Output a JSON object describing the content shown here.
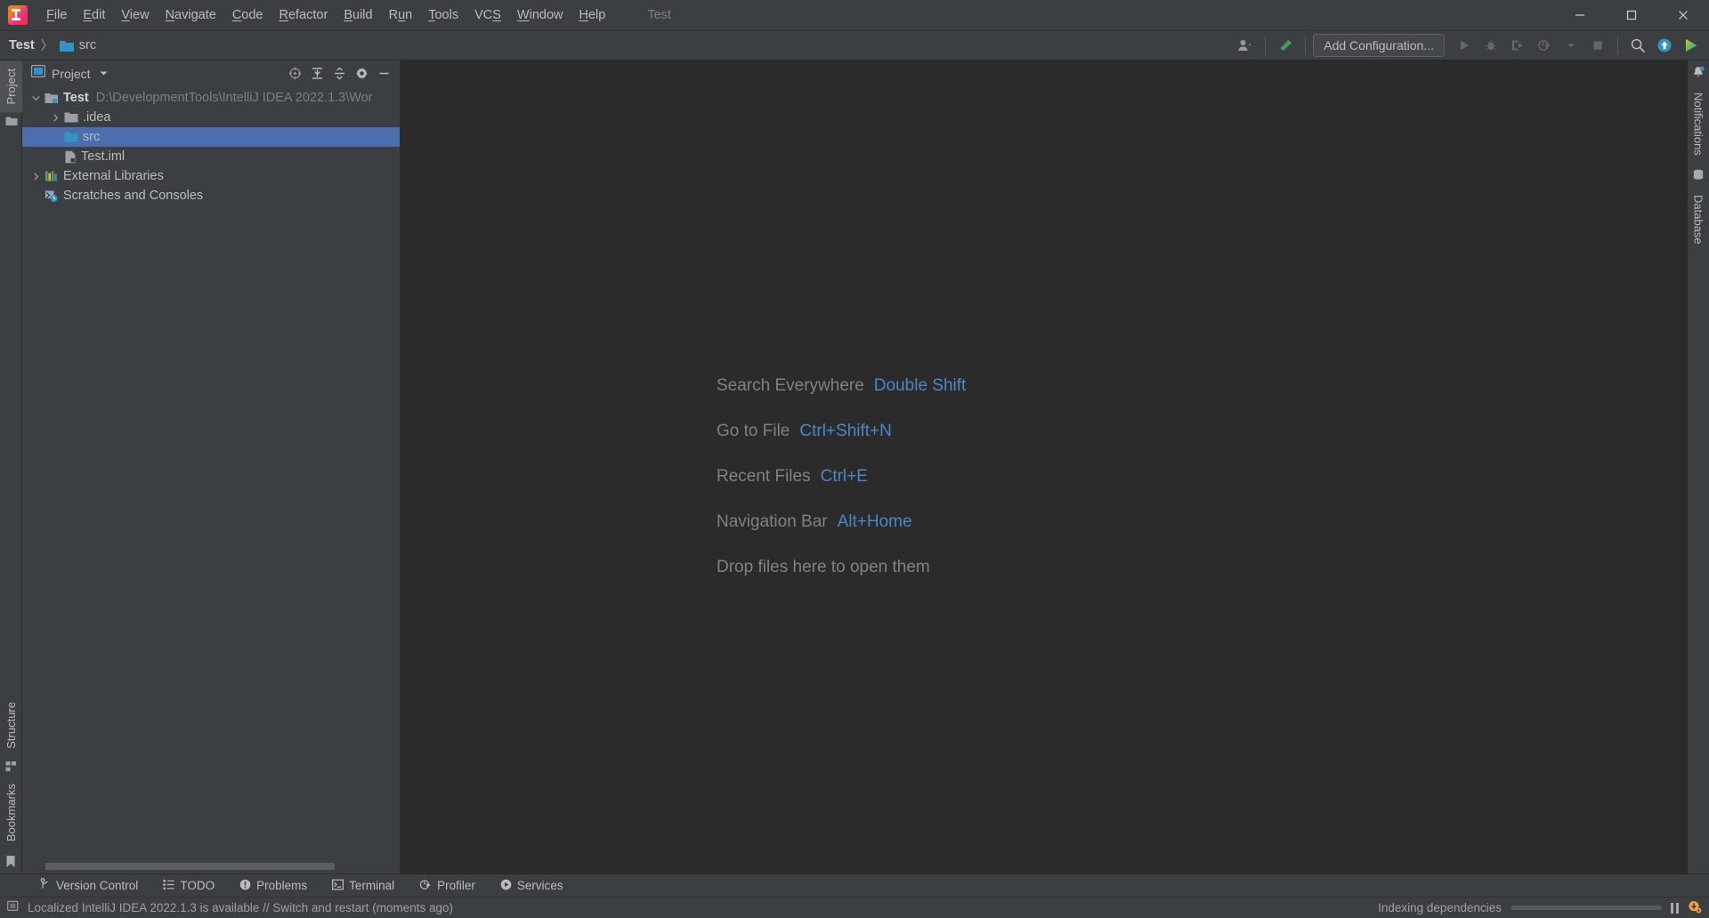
{
  "window": {
    "project_name": "Test",
    "minimize_label": "Minimize",
    "maximize_label": "Maximize",
    "close_label": "Close"
  },
  "menu": {
    "items": [
      {
        "label": "File",
        "mnemonic": "F"
      },
      {
        "label": "Edit",
        "mnemonic": "E"
      },
      {
        "label": "View",
        "mnemonic": "V"
      },
      {
        "label": "Navigate",
        "mnemonic": "N"
      },
      {
        "label": "Code",
        "mnemonic": "C"
      },
      {
        "label": "Refactor",
        "mnemonic": "R"
      },
      {
        "label": "Build",
        "mnemonic": "B"
      },
      {
        "label": "Run",
        "mnemonic": "u"
      },
      {
        "label": "Tools",
        "mnemonic": "T"
      },
      {
        "label": "VCS",
        "mnemonic": "S"
      },
      {
        "label": "Window",
        "mnemonic": "W"
      },
      {
        "label": "Help",
        "mnemonic": "H"
      }
    ]
  },
  "toolbar": {
    "breadcrumb": {
      "root": "Test",
      "separator": "〉",
      "leaf": "src"
    },
    "add_configuration_label": "Add Configuration...",
    "icons": {
      "user": "user-account-icon",
      "build": "build-hammer-icon",
      "run": "run-icon",
      "debug": "debug-icon",
      "run_coverage": "run-with-coverage-icon",
      "profile": "profile-icon",
      "stop": "stop-icon",
      "search": "search-icon",
      "update": "update-project-icon",
      "ide_services": "ide-services-icon"
    }
  },
  "left_strip": {
    "top": [
      {
        "label": "Project",
        "icon": "project-icon",
        "active": true
      },
      {
        "label": "",
        "icon": "folder-icon",
        "active": false
      }
    ],
    "bottom": [
      {
        "label": "Structure",
        "icon": "structure-icon"
      },
      {
        "label": "Bookmarks",
        "icon": "bookmarks-icon"
      }
    ]
  },
  "right_strip": {
    "top": [
      {
        "label": "Notifications",
        "icon": "notifications-bell-icon"
      },
      {
        "label": "Database",
        "icon": "database-icon"
      }
    ]
  },
  "project_panel": {
    "title": "Project",
    "tools": [
      {
        "name": "select-opened-file",
        "label": "Select Opened File"
      },
      {
        "name": "expand-all",
        "label": "Expand All"
      },
      {
        "name": "collapse-all",
        "label": "Collapse All"
      },
      {
        "name": "settings",
        "label": "Options"
      },
      {
        "name": "hide",
        "label": "Hide"
      }
    ],
    "tree": [
      {
        "label": "Test",
        "path": "D:\\DevelopmentTools\\IntelliJ IDEA 2022.1.3\\Wor",
        "icon": "module-icon",
        "indent": 0,
        "arrow": "expanded",
        "bold": true,
        "selected": false
      },
      {
        "label": ".idea",
        "path": "",
        "icon": "folder-grey-icon",
        "indent": 1,
        "arrow": "collapsed",
        "bold": false,
        "selected": false
      },
      {
        "label": "src",
        "path": "",
        "icon": "source-folder-icon",
        "indent": 1,
        "arrow": "none",
        "bold": false,
        "selected": true
      },
      {
        "label": "Test.iml",
        "path": "",
        "icon": "iml-file-icon",
        "indent": 1,
        "arrow": "none",
        "bold": false,
        "selected": false
      },
      {
        "label": "External Libraries",
        "path": "",
        "icon": "libraries-icon",
        "indent": 0,
        "arrow": "collapsed",
        "bold": false,
        "selected": false
      },
      {
        "label": "Scratches and Consoles",
        "path": "",
        "icon": "scratches-icon",
        "indent": 0,
        "arrow": "none",
        "bold": false,
        "selected": false
      }
    ]
  },
  "editor": {
    "tips": [
      {
        "label": "Search Everywhere",
        "key": "Double Shift"
      },
      {
        "label": "Go to File",
        "key": "Ctrl+Shift+N"
      },
      {
        "label": "Recent Files",
        "key": "Ctrl+E"
      },
      {
        "label": "Navigation Bar",
        "key": "Alt+Home"
      },
      {
        "label": "Drop files here to open them",
        "key": ""
      }
    ]
  },
  "bottom_bar": {
    "items": [
      {
        "label": "Version Control",
        "icon": "vcs-branch-icon"
      },
      {
        "label": "TODO",
        "icon": "todo-list-icon"
      },
      {
        "label": "Problems",
        "icon": "problems-icon"
      },
      {
        "label": "Terminal",
        "icon": "terminal-icon"
      },
      {
        "label": "Profiler",
        "icon": "profiler-icon"
      },
      {
        "label": "Services",
        "icon": "services-icon"
      }
    ]
  },
  "status_bar": {
    "message": "Localized IntelliJ IDEA 2022.1.3 is available // Switch and restart (moments ago)",
    "message_icon": "ide-update-icon",
    "progress_label": "Indexing dependencies",
    "progress_percent": 100,
    "pause_icon": "pause-icon",
    "notification_icon": "download-update-icon"
  },
  "colors": {
    "accent_blue": "#4a88c7",
    "selection_blue": "#4b6eaf",
    "panel_bg": "#3c3f41",
    "editor_bg": "#2b2b2b",
    "text": "#bbbbbb",
    "muted": "#7b7f82",
    "green": "#499c54",
    "orange": "#e8a33d"
  }
}
